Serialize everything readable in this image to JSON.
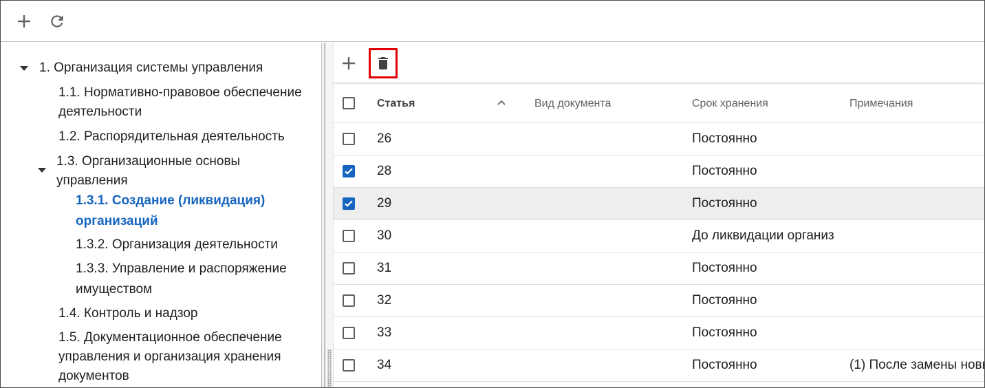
{
  "top_toolbar": {
    "add_icon": "plus-icon",
    "refresh_icon": "refresh-icon"
  },
  "tree": {
    "nodes": [
      {
        "text": "1. Организация системы управления",
        "expanded": true
      },
      {
        "line1": "1.1. Нормативно-правовое обеспечение",
        "line2": "деятельности"
      },
      {
        "text": "1.2. Распорядительная деятельность"
      },
      {
        "line1": "1.3. Организационные основы",
        "line2": "управления",
        "expanded": true
      },
      {
        "line1": "1.3.1. Создание (ликвидация)",
        "line2": "организаций",
        "selected": true
      },
      {
        "text": "1.3.2. Организация деятельности"
      },
      {
        "line1": "1.3.3. Управление и распоряжение",
        "line2": "имуществом"
      },
      {
        "text": "1.4. Контроль и надзор"
      },
      {
        "line1": "1.5. Документационное обеспечение",
        "line2": "управления и организация хранения",
        "line3": "документов"
      }
    ]
  },
  "grid_toolbar": {
    "add_icon": "plus-icon",
    "delete_icon": "trash-icon",
    "highlight_color": "#e00000"
  },
  "grid": {
    "columns": {
      "article": "Статья",
      "doc_type": "Вид документа",
      "retention": "Срок хранения",
      "notes": "Примечания"
    },
    "sort": "ascending",
    "rows": [
      {
        "article": "26",
        "doc_type": "",
        "retention": "Постоянно",
        "notes": "",
        "checked": false
      },
      {
        "article": "28",
        "doc_type": "",
        "retention": "Постоянно",
        "notes": "",
        "checked": true
      },
      {
        "article": "29",
        "doc_type": "",
        "retention": "Постоянно",
        "notes": "",
        "checked": true
      },
      {
        "article": "30",
        "doc_type": "",
        "retention": "До ликвидации организ",
        "notes": "",
        "checked": false
      },
      {
        "article": "31",
        "doc_type": "",
        "retention": "Постоянно",
        "notes": "",
        "checked": false
      },
      {
        "article": "32",
        "doc_type": "",
        "retention": "Постоянно",
        "notes": "",
        "checked": false
      },
      {
        "article": "33",
        "doc_type": "",
        "retention": "Постоянно",
        "notes": "",
        "checked": false
      },
      {
        "article": "34",
        "doc_type": "",
        "retention": "Постоянно",
        "notes": "(1) После замены новы",
        "checked": false
      }
    ]
  },
  "colors": {
    "accent": "#1565c0",
    "selected_text": "#1565c0"
  }
}
